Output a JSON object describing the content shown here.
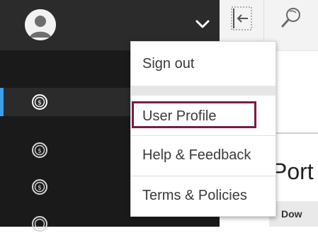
{
  "user_menu": {
    "items": [
      {
        "label": "Sign out"
      },
      {
        "label": "User Profile"
      },
      {
        "label": "Help & Feedback"
      },
      {
        "label": "Terms & Policies"
      }
    ]
  },
  "page": {
    "title": "Port",
    "table_header": "Dow"
  },
  "icons": {
    "avatar": "user-avatar-icon",
    "expand": "chevron-down-icon",
    "collapse": "collapse-panel-icon",
    "search": "search-icon",
    "nav": "dollar-coin-icon"
  },
  "colors": {
    "sidebar": "#1a1a1a",
    "active_indicator": "#3aa0e8",
    "highlight_border": "#7a1c47"
  }
}
